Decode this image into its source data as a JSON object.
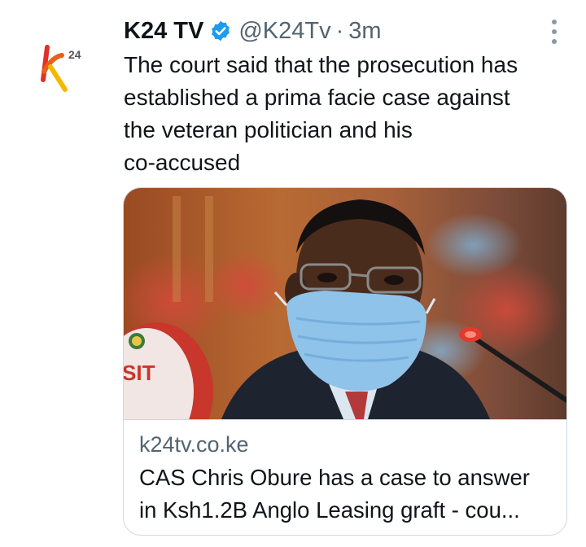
{
  "tweet": {
    "author_name": "K24 TV",
    "verified_icon": "verified-badge-icon",
    "handle": "@K24Tv",
    "separator": "·",
    "time": "3m",
    "text_lines": [
      "The court said that the prosecution has",
      "established a prima facie case against",
      "the veteran politician and his",
      "co-accused"
    ]
  },
  "card": {
    "domain": "k24tv.co.ke",
    "title_lines": [
      "CAS Chris Obure has a case to answer",
      "in Ksh1.2B Anglo Leasing graft - cou..."
    ],
    "image_sign_text": "SIT"
  },
  "colors": {
    "verified": "#1d9bf0",
    "secondary_text": "#536471",
    "logo_red": "#e0312a",
    "logo_yellow": "#f5b800"
  }
}
